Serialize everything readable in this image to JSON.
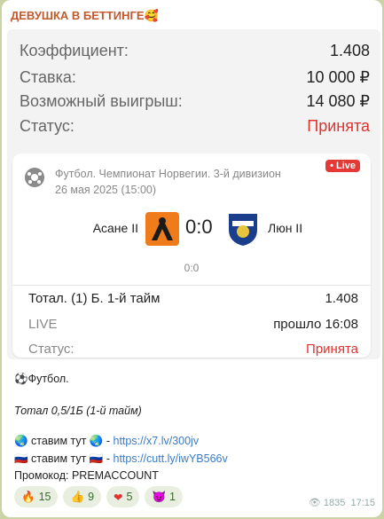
{
  "channel": {
    "name": "ДЕВУШКА В БЕТТИНГЕ🥰"
  },
  "bet": {
    "odds_label": "Коэффициент:",
    "odds_value": "1.408",
    "stake_label": "Ставка:",
    "stake_value": "10 000 ₽",
    "win_label": "Возможный выигрыш:",
    "win_value": "14 080 ₽",
    "status_label": "Статус:",
    "status_value": "Принята"
  },
  "match": {
    "league": "Футбол. Чемпионат Норвегии. 3-й дивизион",
    "date": "26 мая 2025 (15:00)",
    "live_badge": "• Live",
    "team1": "Асане II",
    "team2": "Люн II",
    "score": "0:0",
    "subscore": "0:0",
    "market": "Тотал. (1) Б. 1-й тайм",
    "market_odds": "1.408",
    "live_label": "LIVE",
    "elapsed": "прошло 16:08",
    "status_label": "Статус:",
    "status_value": "Принята"
  },
  "message": {
    "line1": "⚽Футбол.",
    "line2": "Тотал 0,5/1Б (1-й тайм)",
    "line3_text": "🌏 ставим тут 🌏 - ",
    "line3_link": "https://x7.lv/300jv",
    "line4_text": "🇷🇺 ставим тут 🇷🇺 - ",
    "line4_link": "https://cutt.ly/iwYB566v",
    "line5": "Промокод: PREMACCOUNT"
  },
  "reactions": [
    {
      "emoji": "🔥",
      "count": "15"
    },
    {
      "emoji": "👍",
      "count": "9"
    },
    {
      "emoji": "❤",
      "count": "5"
    },
    {
      "emoji": "😈",
      "count": "1"
    }
  ],
  "meta": {
    "views": "1835",
    "time": "17:15"
  },
  "colors": {
    "accent_red": "#e0322e",
    "link": "#3a7bc6",
    "channel": "#c05a2c"
  }
}
